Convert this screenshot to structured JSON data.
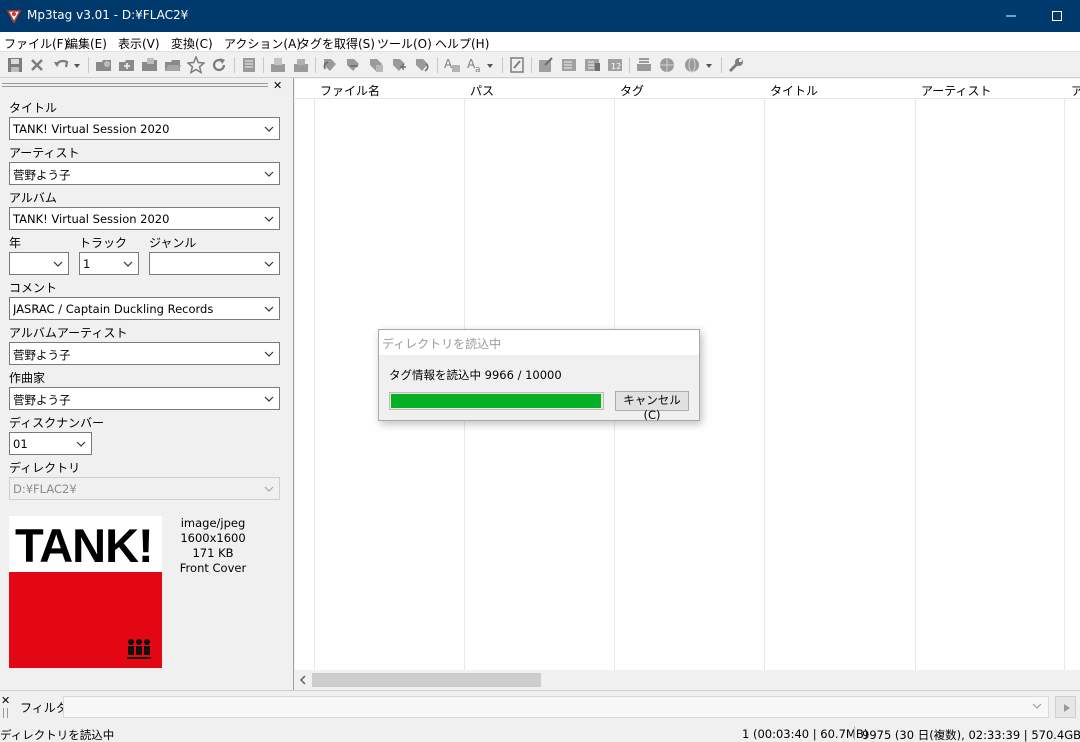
{
  "window": {
    "title": "Mp3tag v3.01  -  D:¥FLAC2¥",
    "controls": [
      "minimize-icon",
      "maximize-icon",
      "close-icon"
    ]
  },
  "menu": [
    "ファイル(F)",
    "編集(E)",
    "表示(V)",
    "変換(C)",
    "アクション(A)",
    "タグを取得(S)",
    "ツール(O)",
    "ヘルプ(H)"
  ],
  "tagpanel": {
    "title": {
      "label": "タイトル",
      "value": "TANK! Virtual Session 2020"
    },
    "artist": {
      "label": "アーティスト",
      "value": "菅野よう子"
    },
    "album": {
      "label": "アルバム",
      "value": "TANK! Virtual Session 2020"
    },
    "year": {
      "label": "年",
      "value": ""
    },
    "track": {
      "label": "トラック",
      "value": "1"
    },
    "genre": {
      "label": "ジャンル",
      "value": ""
    },
    "comment": {
      "label": "コメント",
      "value": "JASRAC / Captain Duckling Records"
    },
    "albumartist": {
      "label": "アルバムアーティスト",
      "value": "菅野よう子"
    },
    "composer": {
      "label": "作曲家",
      "value": "菅野よう子"
    },
    "disc": {
      "label": "ディスクナンバー",
      "value": "01"
    },
    "directory": {
      "label": "ディレクトリ",
      "value": "D:¥FLAC2¥"
    },
    "cover": {
      "art_text": "TANK!",
      "mime": "image/jpeg",
      "dimensions": "1600x1600",
      "size": "171 KB",
      "type": "Front Cover"
    }
  },
  "filelist": {
    "columns": [
      "ファイル名",
      "パス",
      "タグ",
      "タイトル",
      "アーティスト",
      "ア"
    ]
  },
  "filter": {
    "label": "フィルタ:",
    "value": ""
  },
  "status": {
    "left": "ディレクトリを読込中",
    "selected": "1 (00:03:40 | 60.7MB)",
    "total": "9975 (30 日(複数), 02:33:39 | 570.4GB)"
  },
  "dialog": {
    "title": "ディレクトリを読込中",
    "message": "タグ情報を読込中 9966 / 10000",
    "progress": {
      "current": 9966,
      "total": 10000
    },
    "cancel_label": "キャンセル(C)",
    "progress_color": "#06b025"
  },
  "colors": {
    "titlebar": "#003a6c",
    "cover_red": "#e30613"
  }
}
